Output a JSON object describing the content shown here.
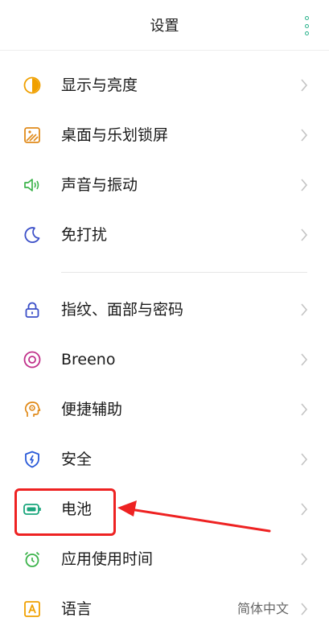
{
  "header": {
    "title": "设置",
    "menu_icon": "more-vertical-icon"
  },
  "settings": [
    {
      "key": "display",
      "label": "显示与亮度",
      "icon": "display-brightness-icon",
      "color": "#f0a000"
    },
    {
      "key": "wallpaper",
      "label": "桌面与乐划锁屏",
      "icon": "wallpaper-icon",
      "color": "#e08a1a"
    },
    {
      "key": "sound",
      "label": "声音与振动",
      "icon": "speaker-icon",
      "color": "#3bb34a"
    },
    {
      "key": "dnd",
      "label": "免打扰",
      "icon": "moon-icon",
      "color": "#3b4fc8"
    },
    {
      "key": "security_lock",
      "label": "指纹、面部与密码",
      "icon": "lock-icon",
      "color": "#3b4fc8"
    },
    {
      "key": "breeno",
      "label": "Breeno",
      "icon": "breeno-icon",
      "color": "#c0308a"
    },
    {
      "key": "accessibility",
      "label": "便捷辅助",
      "icon": "accessibility-icon",
      "color": "#e08a1a"
    },
    {
      "key": "safety",
      "label": "安全",
      "icon": "shield-icon",
      "color": "#2a5ad8"
    },
    {
      "key": "battery",
      "label": "电池",
      "icon": "battery-icon",
      "color": "#1aa67c"
    },
    {
      "key": "app_usage",
      "label": "应用使用时间",
      "icon": "alarm-clock-icon",
      "color": "#3bb34a"
    },
    {
      "key": "language",
      "label": "语言",
      "icon": "language-icon",
      "color": "#f0a000",
      "value": "简体中文"
    }
  ],
  "annotation": {
    "color": "#ee2222",
    "target": "battery"
  },
  "accent": "#2bb38c"
}
